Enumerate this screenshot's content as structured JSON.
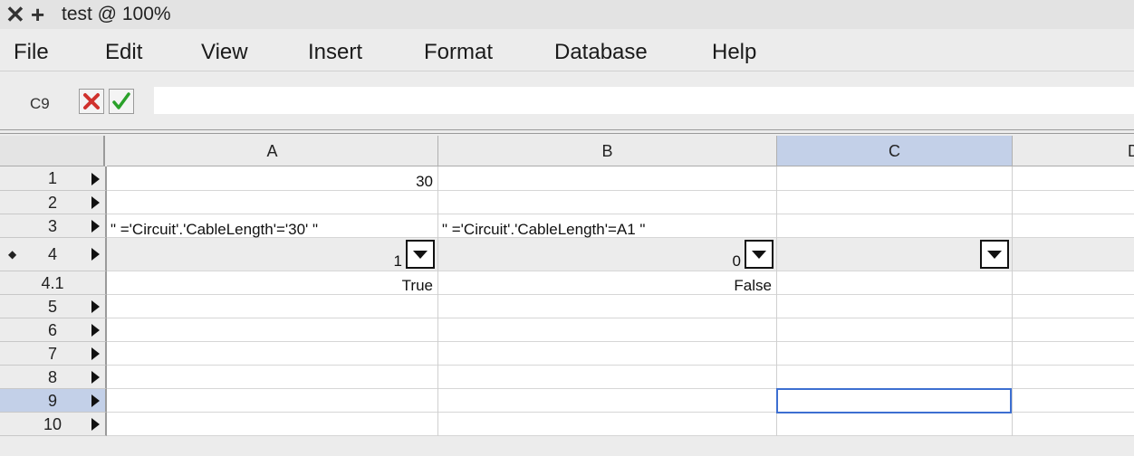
{
  "window": {
    "title": "test @ 100%",
    "close_icon": "x-icon",
    "add_icon": "plus-icon"
  },
  "menu": [
    "File",
    "Edit",
    "View",
    "Insert",
    "Format",
    "Database",
    "Help"
  ],
  "formula_bar": {
    "cell_ref": "C9",
    "cancel_icon": "red-x-icon",
    "accept_icon": "green-check-icon",
    "value": ""
  },
  "columns": [
    "A",
    "B",
    "C",
    "D"
  ],
  "selected_column": "C",
  "rows": [
    {
      "label": "1"
    },
    {
      "label": "2"
    },
    {
      "label": "3"
    },
    {
      "label": "4"
    },
    {
      "label": "4.1"
    },
    {
      "label": "5"
    },
    {
      "label": "6"
    },
    {
      "label": "7"
    },
    {
      "label": "8"
    },
    {
      "label": "9"
    },
    {
      "label": "10"
    }
  ],
  "cells": {
    "A1": "30",
    "A3": "\" ='Circuit'.'CableLength'='30' \"",
    "B3": "\" ='Circuit'.'CableLength'=A1 \"",
    "A4": "1",
    "B4": "0",
    "A4_1": "True",
    "B4_1": "False"
  },
  "selected_cell": "C9",
  "colors": {
    "selection_header": "#c3d0e8",
    "selection_border": "#3d6fd1",
    "cancel": "#d0312d",
    "accept": "#2aa12a"
  }
}
